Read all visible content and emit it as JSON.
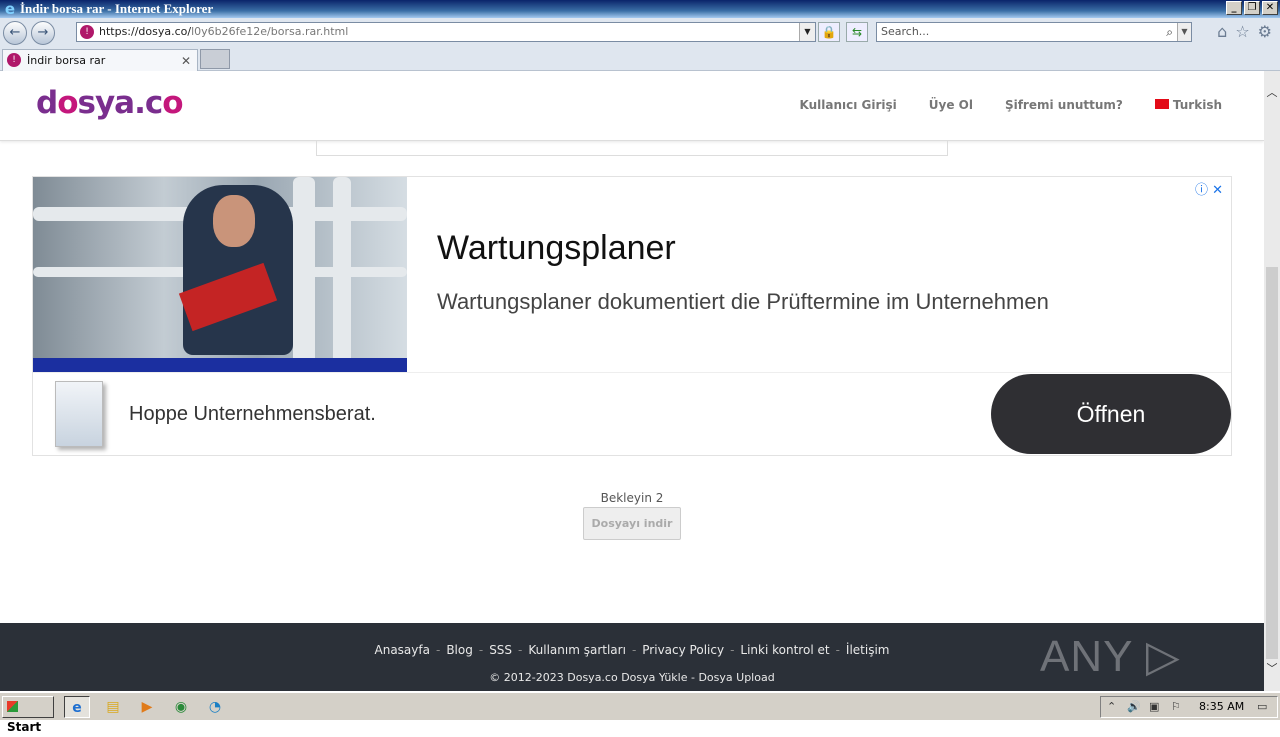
{
  "window": {
    "title": "İndir borsa rar - Internet Explorer",
    "controls": [
      "_",
      "❐",
      "✕"
    ]
  },
  "browser": {
    "url_host": "https://dosya.co/",
    "url_path": "l0y6b26fe12e/borsa.rar.html",
    "search_placeholder": "Search...",
    "tab_label": "İndir borsa rar"
  },
  "site": {
    "logo_part1": "d",
    "logo_o": "o",
    "logo_part2": "sya.c",
    "logo_o2": "o",
    "nav": {
      "login": "Kullanıcı Girişi",
      "register": "Üye Ol",
      "forgot": "Şifremi unuttum?",
      "language": "Turkish"
    }
  },
  "ad": {
    "title": "Wartungsplaner",
    "description": "Wartungsplaner dokumentiert die Prüftermine im Unternehmen",
    "advertiser": "Hoppe Unternehmensberat.",
    "cta": "Öffnen",
    "info_icon": "ⓘ",
    "close_icon": "✕"
  },
  "download": {
    "wait_text": "Bekleyin 2",
    "button_label": "Dosyayı indir"
  },
  "footer": {
    "links": [
      "Anasayfa",
      "Blog",
      "SSS",
      "Kullanım şartları",
      "Privacy Policy",
      "Linki kontrol et",
      "İletişim"
    ],
    "copyright": "© 2012-2023 Dosya.co Dosya Yükle - Dosya Upload",
    "watermark": "ANY ▷ RUN"
  },
  "taskbar": {
    "start_label": "Start",
    "clock": "8:35 AM"
  },
  "colors": {
    "brand_purple": "#7a2e8e",
    "brand_pink": "#c4177c",
    "footer_bg": "#2b3038",
    "cta_bg": "#2f2f33"
  }
}
